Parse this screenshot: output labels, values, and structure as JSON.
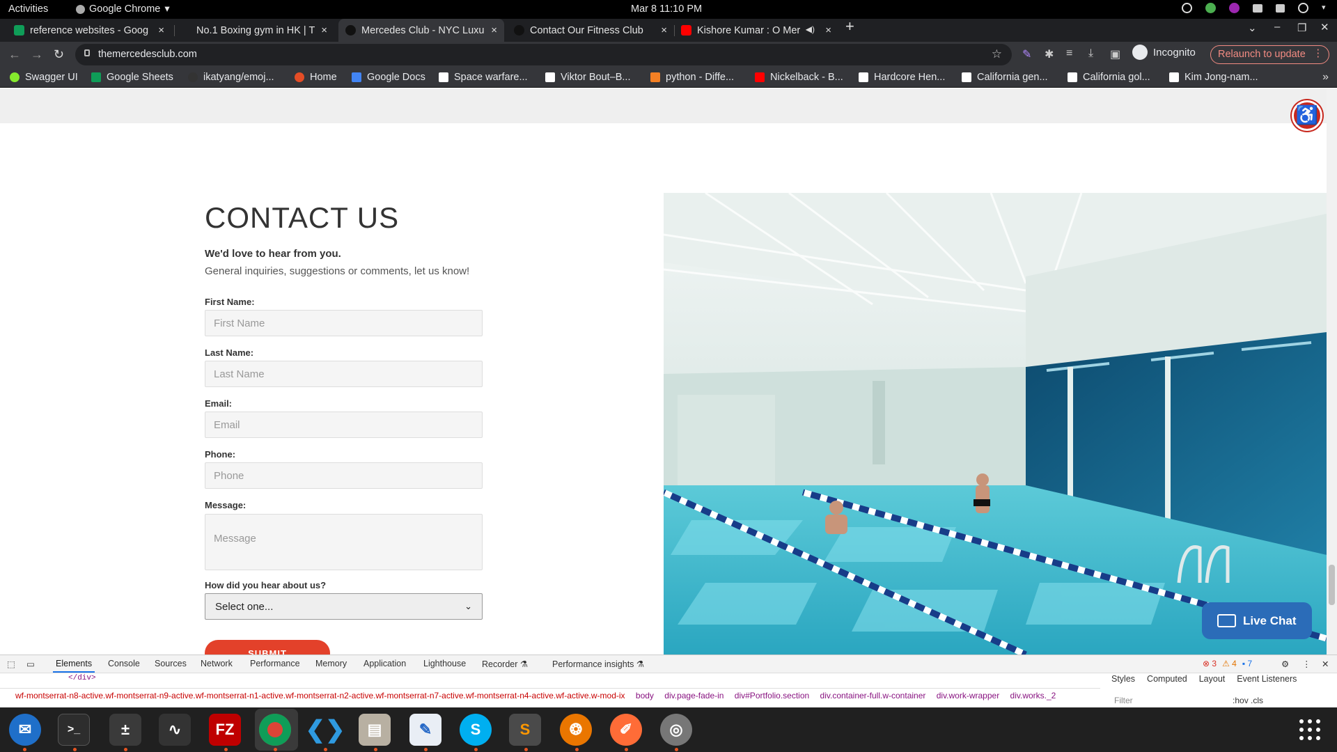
{
  "os": {
    "activities": "Activities",
    "app": "Google Chrome",
    "clock": "Mar 8  11:10 PM"
  },
  "tabs": [
    {
      "title": "reference websites - Goog",
      "color": "#0f9d58"
    },
    {
      "title": "No.1 Boxing gym in HK | T",
      "color": "#1f2023"
    },
    {
      "title": "Mercedes Club - NYC Luxu",
      "color": "#000000"
    },
    {
      "title": "Contact Our Fitness Club",
      "color": "#000000"
    },
    {
      "title": "Kishore Kumar : O Mer",
      "color": "#ff0000"
    }
  ],
  "omnibox": {
    "url": "themercedesclub.com",
    "incognito": "Incognito",
    "relaunch": "Relaunch to update"
  },
  "bookmarks": [
    {
      "label": "Swagger UI",
      "color": "#85ea2d"
    },
    {
      "label": "Google Sheets",
      "color": "#0f9d58"
    },
    {
      "label": "ikatyang/emoj...",
      "color": "#333333"
    },
    {
      "label": "Home",
      "color": "#e44d26"
    },
    {
      "label": "Google Docs",
      "color": "#4285f4"
    },
    {
      "label": "Space warfare...",
      "color": "#ffffff"
    },
    {
      "label": "Viktor Bout–B...",
      "color": "#ffffff"
    },
    {
      "label": "python - Diffe...",
      "color": "#f48024"
    },
    {
      "label": "Nickelback - B...",
      "color": "#ff0000"
    },
    {
      "label": "Hardcore Hen...",
      "color": "#ffffff"
    },
    {
      "label": "California gen...",
      "color": "#ffffff"
    },
    {
      "label": "California gol...",
      "color": "#ffffff"
    },
    {
      "label": "Kim Jong-nam...",
      "color": "#ffffff"
    }
  ],
  "contact": {
    "title": "CONTACT US",
    "lead": "We'd love to hear from you.",
    "sub": "General inquiries, suggestions or comments, let us know!",
    "first_label": "First Name:",
    "first_ph": "First Name",
    "last_label": "Last Name:",
    "last_ph": "Last Name",
    "email_label": "Email:",
    "email_ph": "Email",
    "phone_label": "Phone:",
    "phone_ph": "Phone",
    "message_label": "Message:",
    "message_ph": "Message",
    "hear_label": "How did you hear about us?",
    "hear_value": "Select one...",
    "submit": "SUBMIT"
  },
  "livechat": "Live Chat",
  "devtools": {
    "tabs": [
      "Elements",
      "Console",
      "Sources",
      "Network",
      "Performance",
      "Memory",
      "Application",
      "Lighthouse",
      "Recorder ⚗",
      "Performance insights ⚗"
    ],
    "errors": "3",
    "warnings": "4",
    "messages": "7",
    "code": "</div>",
    "breadcrumbs": [
      "wf-montserrat-n8-active.wf-montserrat-n9-active.wf-montserrat-n1-active.wf-montserrat-n2-active.wf-montserrat-n7-active.wf-montserrat-n4-active.wf-active.w-mod-ix",
      "body",
      "div.page-fade-in",
      "div#Portfolio.section",
      "div.container-full.w-container",
      "div.work-wrapper",
      "div.works._2"
    ],
    "side_tabs": [
      "Styles",
      "Computed",
      "Layout",
      "Event Listeners"
    ],
    "filter": "Filter",
    "filter_flags": ":hov  .cls"
  }
}
